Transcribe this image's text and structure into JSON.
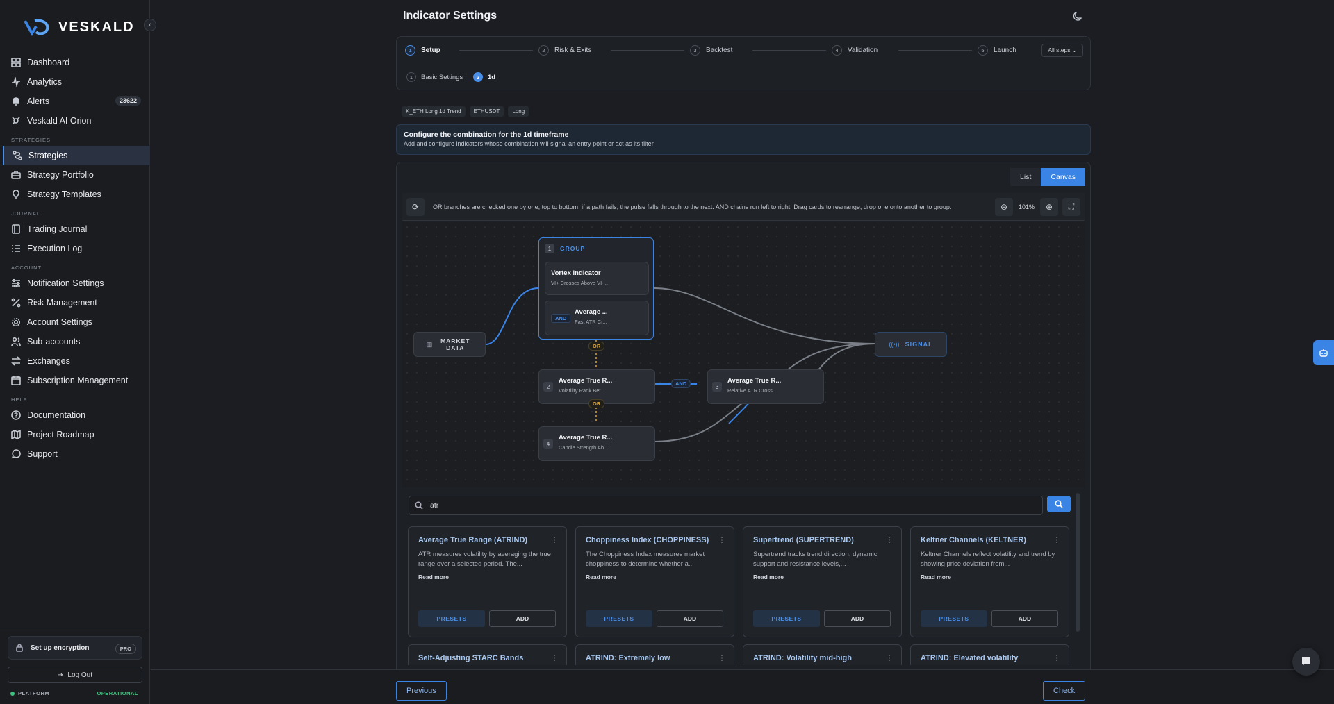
{
  "brand": {
    "name": "VESKALD"
  },
  "sidebar": {
    "main_items": [
      {
        "label": "Dashboard",
        "icon": "grid-icon"
      },
      {
        "label": "Analytics",
        "icon": "activity-icon"
      },
      {
        "label": "Alerts",
        "icon": "bell-icon",
        "badge": "23622"
      },
      {
        "label": "Veskald AI Orion",
        "icon": "orion-icon"
      }
    ],
    "sections": [
      {
        "label": "STRATEGIES",
        "items": [
          "Strategies",
          "Strategy Portfolio",
          "Strategy Templates"
        ]
      },
      {
        "label": "JOURNAL",
        "items": [
          "Trading Journal",
          "Execution Log"
        ]
      },
      {
        "label": "ACCOUNT",
        "items": [
          "Notification Settings",
          "Risk Management",
          "Account Settings",
          "Sub-accounts",
          "Exchanges",
          "Subscription Management"
        ]
      },
      {
        "label": "HELP",
        "items": [
          "Documentation",
          "Project Roadmap",
          "Support"
        ]
      }
    ],
    "active_item": "Strategies",
    "encryption": {
      "label": "Set up encryption",
      "badge": "PRO"
    },
    "logout": "Log Out",
    "platform_label": "PLATFORM",
    "platform_status": "OPERATIONAL"
  },
  "page": {
    "title": "Indicator Settings"
  },
  "stepper": {
    "steps": [
      {
        "num": "1",
        "label": "Setup"
      },
      {
        "num": "2",
        "label": "Risk & Exits"
      },
      {
        "num": "3",
        "label": "Backtest"
      },
      {
        "num": "4",
        "label": "Validation"
      },
      {
        "num": "5",
        "label": "Launch"
      }
    ],
    "all_steps": "All steps",
    "substeps": [
      {
        "num": "1",
        "label": "Basic Settings"
      },
      {
        "num": "2",
        "label": "1d"
      }
    ]
  },
  "tags": [
    "K_ETH Long 1d Trend",
    "ETHUSDT",
    "Long"
  ],
  "info": {
    "title": "Configure the combination for the 1d timeframe",
    "subtitle": "Add and configure indicators whose combination will signal an entry point or act as its filter."
  },
  "view_toggle": {
    "list": "List",
    "canvas": "Canvas",
    "selected": "Canvas"
  },
  "toolbar": {
    "hint": "OR branches are checked one by one, top to bottom: if a path fails, the pulse falls through to the next. AND chains run left to right. Drag cards to rearrange, drop one onto another to group.",
    "zoom": "101%"
  },
  "graph": {
    "market_data": "MARKET DATA",
    "signal": "SIGNAL",
    "group_num": "1",
    "group_label": "GROUP",
    "group_cards": [
      {
        "title": "Vortex Indicator",
        "sub": "VI+ Crosses Above VI-..."
      },
      {
        "title": "Average ...",
        "sub": "Fast ATR Cr...",
        "tag": "AND"
      }
    ],
    "nodes": [
      {
        "num": "2",
        "title": "Average True R...",
        "sub": "Volatility Rank Bet..."
      },
      {
        "num": "3",
        "title": "Average True R...",
        "sub": "Relative ATR Cross ..."
      },
      {
        "num": "4",
        "title": "Average True R...",
        "sub": "Candle Strength Ab..."
      }
    ],
    "or_label": "OR",
    "and_label": "AND"
  },
  "library": {
    "search_value": "atr",
    "read_more": "Read more",
    "presets_label": "PRESETS",
    "add_label": "ADD",
    "cards": [
      {
        "title": "Average True Range (ATRIND)",
        "desc": "ATR measures volatility by averaging the true range over a selected period. The..."
      },
      {
        "title": "Choppiness Index (CHOPPINESS)",
        "desc": "The Choppiness Index measures market choppiness to determine whether a..."
      },
      {
        "title": "Supertrend (SUPERTREND)",
        "desc": "Supertrend tracks trend direction, dynamic support and resistance levels,..."
      },
      {
        "title": "Keltner Channels (KELTNER)",
        "desc": "Keltner Channels reflect volatility and trend by showing price deviation from..."
      }
    ],
    "next_cards": [
      "Self-Adjusting STARC Bands",
      "ATRIND: Extremely low",
      "ATRIND: Volatility mid-high",
      "ATRIND: Elevated volatility"
    ]
  },
  "footer": {
    "previous": "Previous",
    "check": "Check"
  }
}
